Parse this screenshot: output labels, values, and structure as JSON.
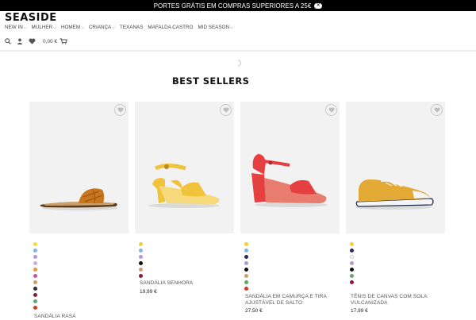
{
  "topbar": {
    "message": "PORTES GRÁTIS EM COMPRAS SUPERIORES A 25€",
    "close_label": "✕"
  },
  "header": {
    "logo": "SEASIDE",
    "nav": [
      {
        "label": "NEW IN",
        "has_dropdown": true
      },
      {
        "label": "MULHER",
        "has_dropdown": true
      },
      {
        "label": "HOMEM",
        "has_dropdown": true
      },
      {
        "label": "CRIANÇA",
        "has_dropdown": true
      },
      {
        "label": "TEXANAS",
        "has_dropdown": false
      },
      {
        "label": "MAFALDA CASTRO",
        "has_dropdown": false
      },
      {
        "label": "MID SEASON",
        "has_dropdown": true
      }
    ],
    "cart_total": "0,00 €"
  },
  "section": {
    "title": "BEST SELLERS"
  },
  "products": [
    {
      "name": "SANDÁLIA RASA",
      "price": "",
      "image": "brown-slide-sandal",
      "swatches": [
        "#f2e03a",
        "#7fb6e8",
        "#b39ad6",
        "#d8a9c9",
        "#e8944a",
        "#c05a9e",
        "#c8a070",
        "#333333",
        "#8b1a3a",
        "#5fa86a",
        "#d23a2a"
      ]
    },
    {
      "name": "SANDÁLIA SENHORA",
      "price": "19,99 €",
      "image": "yellow-block-heel-sandal",
      "swatches": [
        "#f0d230",
        "#7fb6e8",
        "#b39ad6",
        "#111111",
        "#c8a070",
        "#8b1a3a"
      ]
    },
    {
      "name": "SANDÁLIA EM CAMURÇA E TIRA AJUSTÁVEL DE SALTO",
      "price": "27,50 €",
      "image": "red-block-heel-sandal",
      "swatches": [
        "#f0d230",
        "#7fb6e8",
        "#2a2a5a",
        "#b39ad6",
        "#111111",
        "#c8a070",
        "#5fa86a",
        "#d23a2a"
      ]
    },
    {
      "name": "TÉNIS DE CANVAS COM SOLA VULCANIZADA",
      "price": "17,99 €",
      "image": "mustard-canvas-sneaker",
      "swatches": [
        "#f0d230",
        "#2a2a5a",
        "#ffffff",
        "#b39ad6",
        "#111111",
        "#5fa86a",
        "#8b1a3a"
      ]
    }
  ]
}
